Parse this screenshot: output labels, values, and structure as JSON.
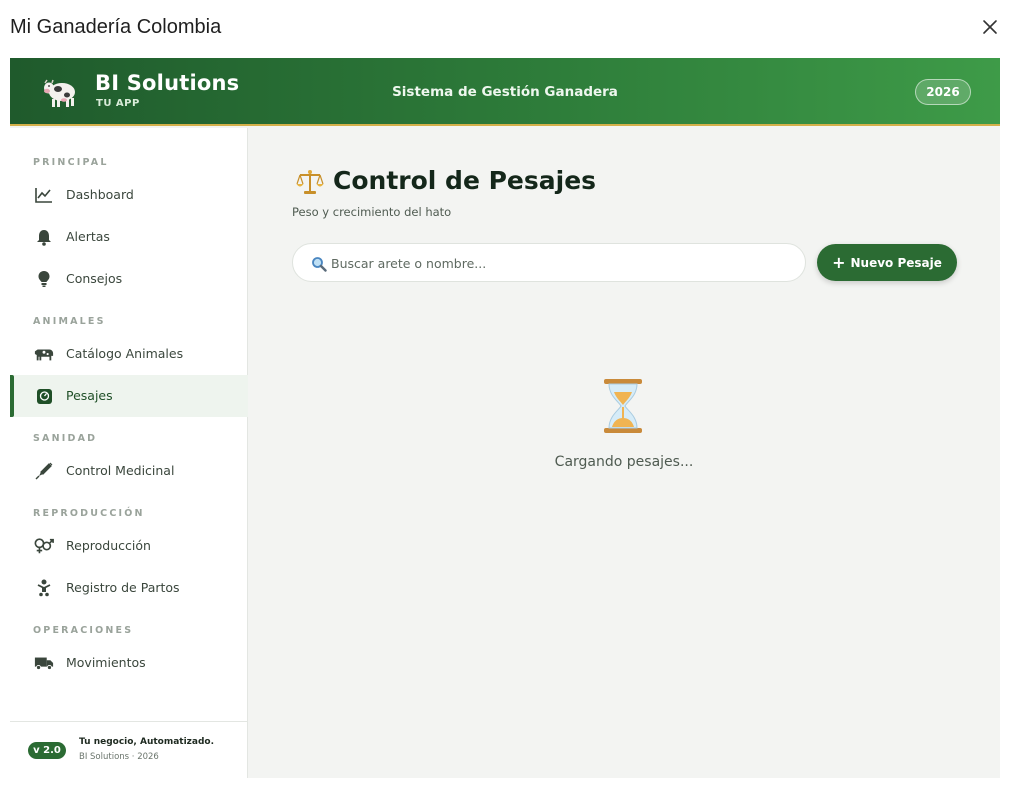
{
  "window": {
    "title": "Mi Ganadería Colombia"
  },
  "header": {
    "brand_name": "BI Solutions",
    "brand_sub": "TU APP",
    "center_title": "Sistema de Gestión Ganadera",
    "year": "2026"
  },
  "sidebar": {
    "sections": {
      "principal": "PRINCIPAL",
      "animales": "ANIMALES",
      "sanidad": "SANIDAD",
      "reproduccion": "REPRODUCCIÓN",
      "operaciones": "OPERACIONES"
    },
    "items": {
      "dashboard": "Dashboard",
      "alertas": "Alertas",
      "consejos": "Consejos",
      "catalogo": "Catálogo Animales",
      "pesajes": "Pesajes",
      "medicinal": "Control Medicinal",
      "reproduccion": "Reproducción",
      "partos": "Registro de Partos",
      "movimientos": "Movimientos"
    },
    "active_item": "pesajes",
    "footer": {
      "version": "v 2.0",
      "tagline": "Tu negocio, Automatizado.",
      "copyright": "BI Solutions · 2026"
    }
  },
  "main": {
    "title": "Control de Pesajes",
    "subtitle": "Peso y crecimiento del hato",
    "search_placeholder": "Buscar arete o nombre...",
    "new_button_label": "Nuevo Pesaje",
    "loading_text": "Cargando pesajes..."
  },
  "colors": {
    "primary": "#2b6b33",
    "header_start": "#1f5a2c",
    "header_end": "#3e9b48",
    "accent_gold": "#d4b04a"
  }
}
